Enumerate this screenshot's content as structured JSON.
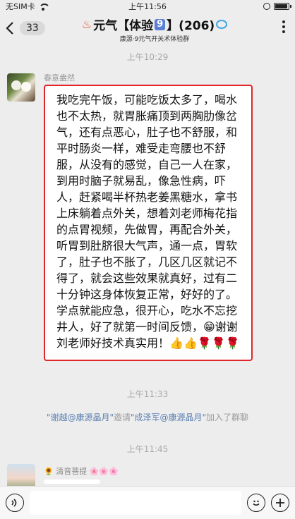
{
  "status_bar": {
    "carrier": "无SIM卡",
    "time": "上午11:56",
    "battery_level": 0.85
  },
  "header": {
    "unread_count": "33",
    "title_prefix": "元气【体验",
    "title_badge": "9",
    "title_suffix": "】(206)",
    "subtitle": "康源·9元气开关术体验群"
  },
  "messages": {
    "time1": "上午10:29",
    "sender1": "春意盎然",
    "text1": "我吃完午饭，可能吃饭太多了，喝水也不太热，就胃胀痛顶到两胸肋像岔气，还有点恶心，肚子也不舒服，和平时肠炎一样，难受走弯腰也不舒服，从没有的感觉，自己一人在家，到用时脑子就易乱，像急性病，吓人，赶紧喝半杯热老姜黑糖水，拿书上床躺着点外关，想着刘老师梅花指的点胃视频，先做胃，再配合外关，听胃到肚脐很大气声，通一点，胃软了，肚子也不胀了，几区几区就记不得了，就会这些效果就真好，过有二十分钟这身体恢复正常，好好的了。学点就能应急，很开心，吃水不忘挖井人，好了就第一时间反馈，",
    "text1_tail": "谢谢刘老师好技术真实用！",
    "emoji_grin": "😁",
    "emoji_tail": "👍👍🌹🌹🌹",
    "time2": "上午11:33",
    "sys_name1": "\"谢越@康源晶月\"",
    "sys_verb": "邀请",
    "sys_name2": "\"成泽军@康源晶月\"",
    "sys_tail": "加入了群聊",
    "time3": "上午11:45",
    "sender2_prefix": "🌻",
    "sender2": "清音菩提",
    "sender2_suffix": "🌸🌸🌸"
  },
  "input_bar": {
    "voice_icon": "voice-icon",
    "emoji_icon": "emoji-icon",
    "plus_icon": "plus-icon"
  }
}
